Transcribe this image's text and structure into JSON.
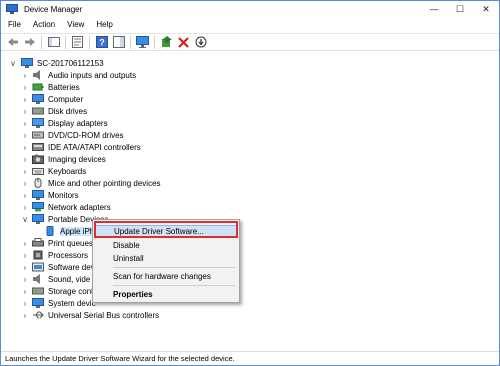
{
  "window": {
    "title": "Device Manager"
  },
  "menu": [
    "File",
    "Action",
    "View",
    "Help"
  ],
  "tree": {
    "root": "SC-201706112153",
    "items": [
      "Audio inputs and outputs",
      "Batteries",
      "Computer",
      "Disk drives",
      "Display adapters",
      "DVD/CD-ROM drives",
      "IDE ATA/ATAPI controllers",
      "Imaging devices",
      "Keyboards",
      "Mice and other pointing devices",
      "Monitors",
      "Network adapters",
      "Portable Devices",
      "Apple iPh",
      "Print queues",
      "Processors",
      "Software devi",
      "Sound, vide",
      "Storage cont",
      "System devic",
      "Universal Serial Bus controllers"
    ]
  },
  "context_menu": {
    "update": "Update Driver Software...",
    "disable": "Disable",
    "uninstall": "Uninstall",
    "scan": "Scan for hardware changes",
    "properties": "Properties"
  },
  "status": "Launches the Update Driver Software Wizard for the selected device.",
  "colors": {
    "highlight_border": "#e32b2b",
    "selection": "#cce8ff"
  }
}
